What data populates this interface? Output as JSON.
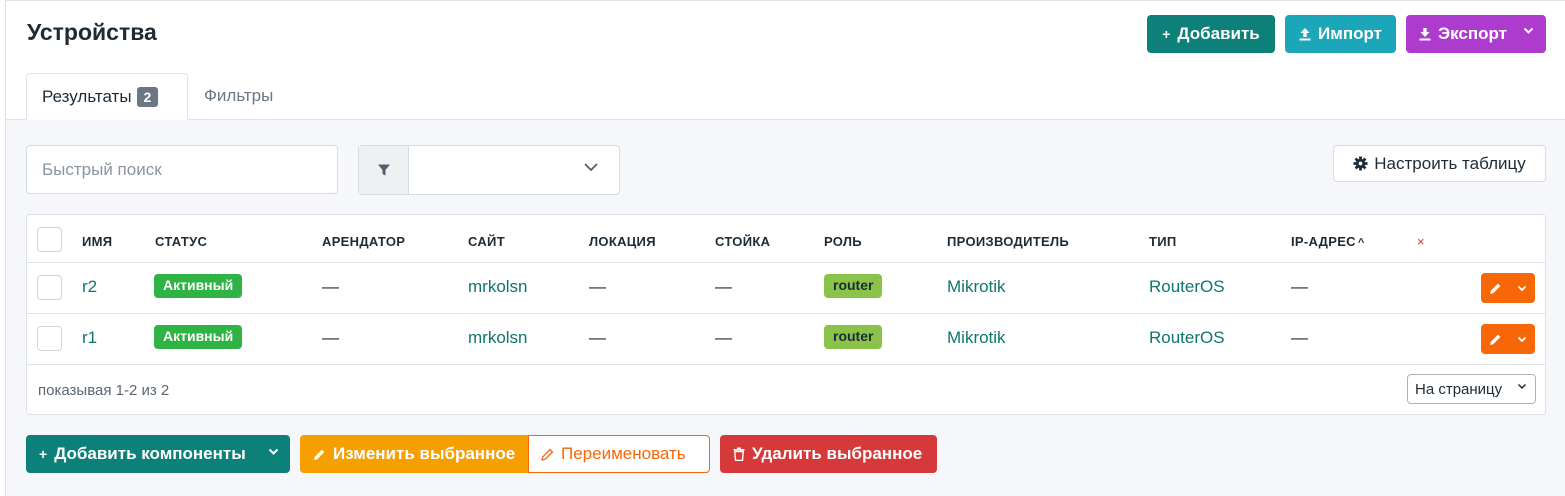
{
  "page": {
    "title": "Устройства"
  },
  "header_buttons": {
    "add_label": "Добавить",
    "import_label": "Импорт",
    "export_label": "Экспорт"
  },
  "tabs": {
    "results_label": "Результаты",
    "results_count": "2",
    "filters_label": "Фильтры"
  },
  "toolbar": {
    "search_placeholder": "Быстрый поиск",
    "filter_value": "",
    "configure_label": "Настроить таблицу"
  },
  "table": {
    "columns": [
      "ИМЯ",
      "СТАТУС",
      "АРЕНДАТОР",
      "САЙТ",
      "ЛОКАЦИЯ",
      "СТОЙКА",
      "РОЛЬ",
      "ПРОИЗВОДИТЕЛЬ",
      "ТИП",
      "IP-АДРЕС"
    ],
    "sort_indicator": "^",
    "clear_sort_symbol": "×",
    "rows": [
      {
        "name": "r2",
        "status": "Активный",
        "tenant": "—",
        "site": "mrkolsn",
        "location": "—",
        "rack": "—",
        "role": "router",
        "manufacturer": "Mikrotik",
        "type": "RouterOS",
        "ip": "—"
      },
      {
        "name": "r1",
        "status": "Активный",
        "tenant": "—",
        "site": "mrkolsn",
        "location": "—",
        "rack": "—",
        "role": "router",
        "manufacturer": "Mikrotik",
        "type": "RouterOS",
        "ip": "—"
      }
    ],
    "footer_text": "показывая 1-2 из 2",
    "per_page_label": "На страницу"
  },
  "bulk_actions": {
    "add_components_label": "Добавить компоненты",
    "edit_selected_label": "Изменить выбранное",
    "rename_label": "Переименовать",
    "delete_selected_label": "Удалить выбранное"
  },
  "colors": {
    "primary": "#0d8079",
    "info": "#1ba6b9",
    "purple": "#ad3bce",
    "status_active": "#2fb344",
    "role": "#8bc34a",
    "warning": "#f59f00",
    "orange": "#f76707",
    "danger": "#d63939"
  }
}
